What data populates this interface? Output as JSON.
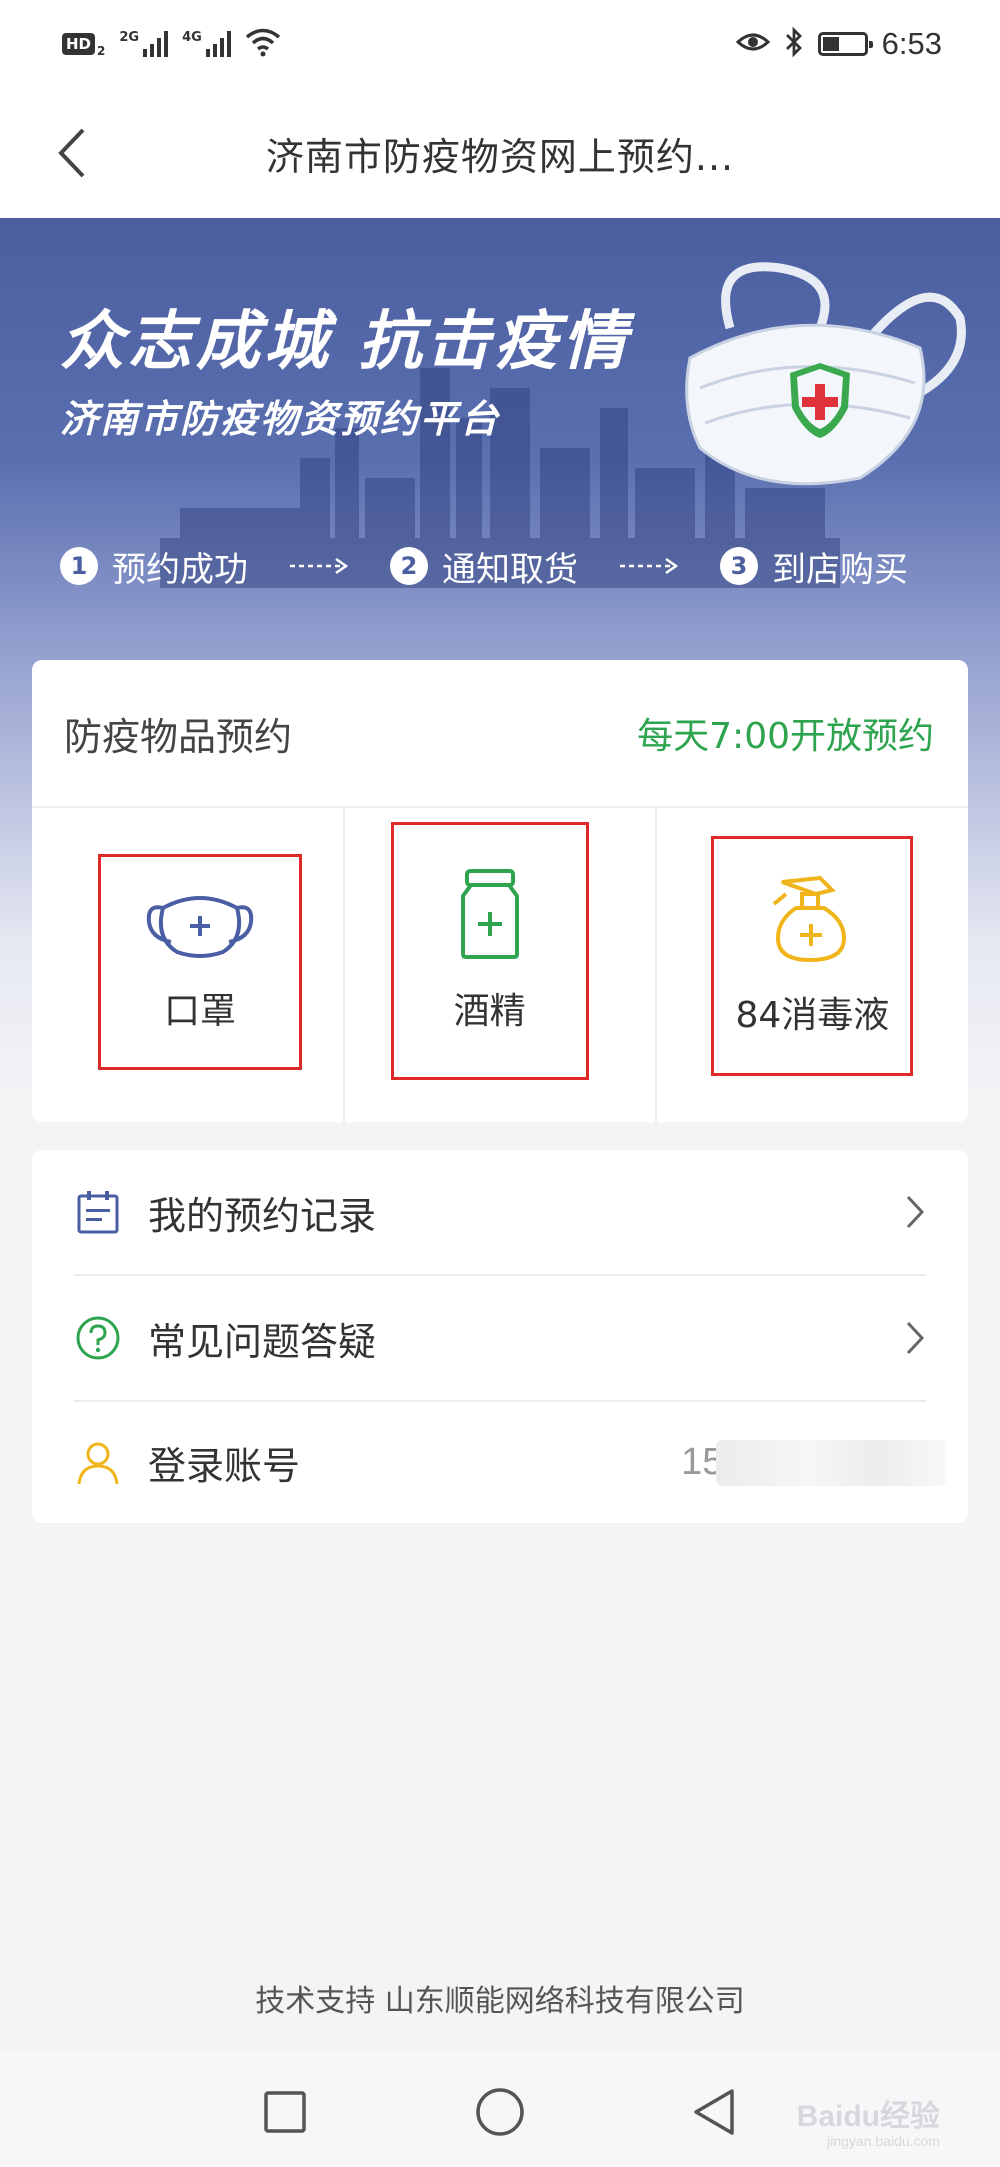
{
  "status_bar": {
    "hd_label": "HD",
    "hd_sub": "2",
    "net1_label": "2G",
    "net2_label": "4G",
    "time": "6:53",
    "battery_level": 0.4
  },
  "title_bar": {
    "title": "济南市防疫物资网上预约..."
  },
  "hero": {
    "title": "众志成城 抗击疫情",
    "subtitle": "济南市防疫物资预约平台",
    "steps": [
      {
        "num": "1",
        "label": "预约成功"
      },
      {
        "num": "2",
        "label": "通知取货"
      },
      {
        "num": "3",
        "label": "到店购买"
      }
    ]
  },
  "booking": {
    "title": "防疫物品预约",
    "note": "每天7:00开放预约",
    "items": [
      {
        "label": "口罩",
        "icon": "face-mask-icon"
      },
      {
        "label": "酒精",
        "icon": "alcohol-bottle-icon"
      },
      {
        "label": "84消毒液",
        "icon": "spray-bottle-icon"
      }
    ]
  },
  "menu": {
    "records": "我的预约记录",
    "faq": "常见问题答疑",
    "account": "登录账号",
    "account_value": "15("
  },
  "footer": {
    "text": "技术支持  山东顺能网络科技有限公司"
  },
  "watermark": {
    "brand": "Baidu经验",
    "url": "jingyan.baidu.com"
  },
  "colors": {
    "hero": "#4b5ea0",
    "green": "#2ea44f",
    "orange": "#f1b51c",
    "highlight": "#e02a2a"
  }
}
